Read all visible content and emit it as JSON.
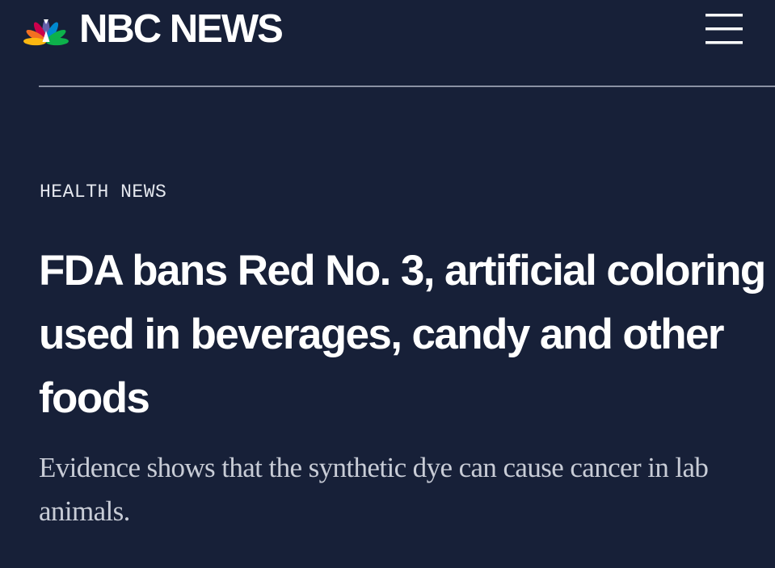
{
  "header": {
    "brand": "NBC NEWS",
    "menu_icon": "hamburger-menu-icon",
    "logo_icon": "nbc-peacock-icon"
  },
  "article": {
    "section": "HEALTH NEWS",
    "headline": "FDA bans Red No. 3, artificial coloring used in beverages, candy and other foods",
    "subheadline": "Evidence shows that the synthetic dye can cause cancer in lab animals."
  },
  "colors": {
    "background": "#172038",
    "headline_text": "#ffffff",
    "subhead_text": "#c8ccd6",
    "divider": "#8b92a3",
    "peacock": [
      "#fcb711",
      "#f37021",
      "#cc004c",
      "#6460aa",
      "#0089d0",
      "#0db14b"
    ]
  }
}
